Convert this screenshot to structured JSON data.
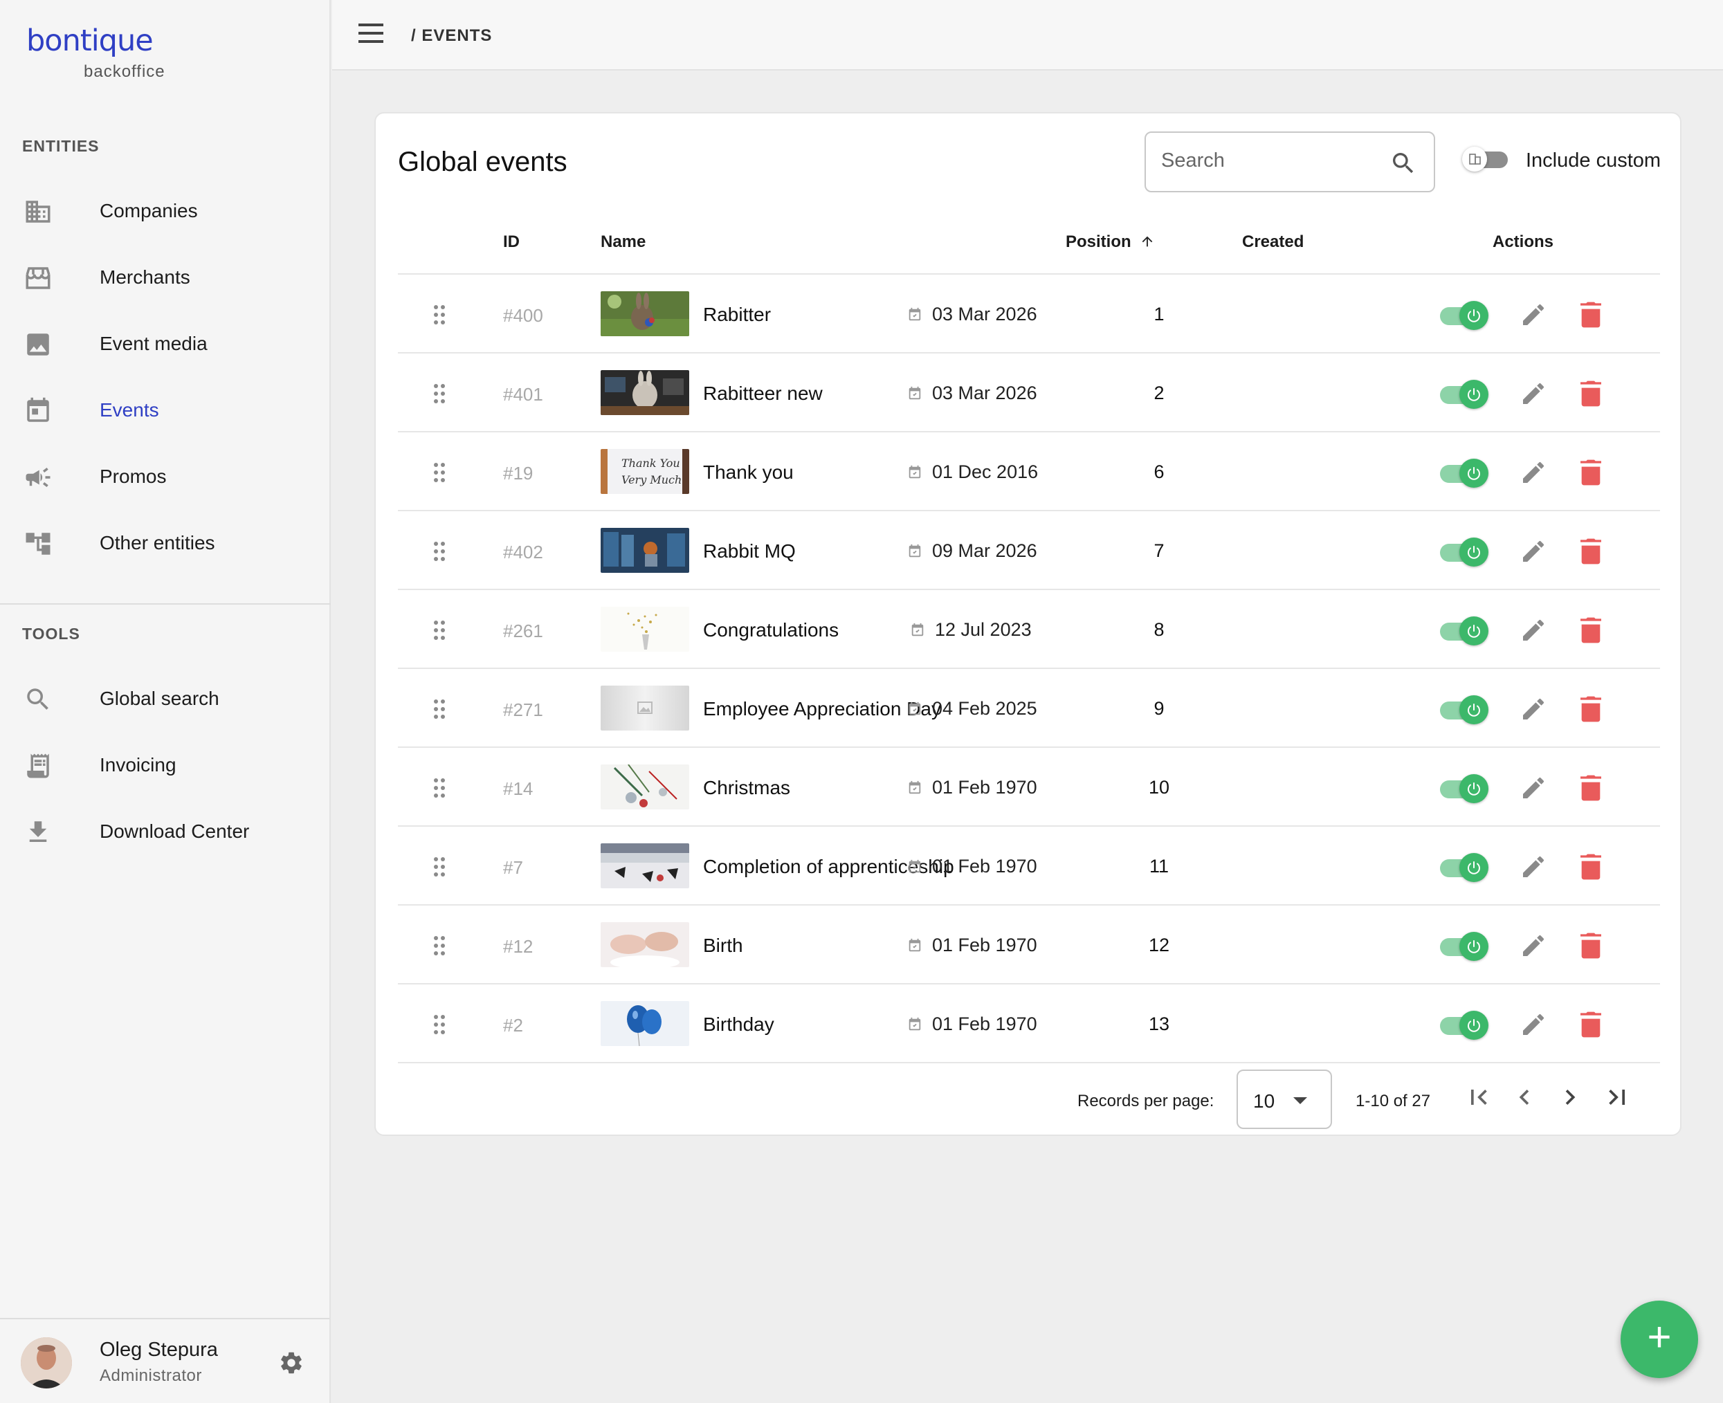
{
  "brand": {
    "name": "bontique",
    "subtitle": "backoffice",
    "color": "#2f3fc4"
  },
  "sidebar": {
    "entities_label": "ENTITIES",
    "entities": [
      {
        "label": "Companies",
        "icon": "building-icon"
      },
      {
        "label": "Merchants",
        "icon": "storefront-icon"
      },
      {
        "label": "Event media",
        "icon": "image-icon"
      },
      {
        "label": "Events",
        "icon": "calendar-icon",
        "active": true
      },
      {
        "label": "Promos",
        "icon": "megaphone-icon"
      },
      {
        "label": "Other entities",
        "icon": "hierarchy-icon"
      }
    ],
    "tools_label": "TOOLS",
    "tools": [
      {
        "label": "Global search",
        "icon": "search-icon"
      },
      {
        "label": "Invoicing",
        "icon": "receipt-icon"
      },
      {
        "label": "Download Center",
        "icon": "download-icon"
      }
    ],
    "user": {
      "name": "Oleg Stepura",
      "role": "Administrator"
    }
  },
  "topbar": {
    "breadcrumb": "/ EVENTS"
  },
  "main": {
    "title": "Global events",
    "search": {
      "placeholder": "Search",
      "value": ""
    },
    "include_custom": {
      "label": "Include custom",
      "on": false
    },
    "columns": {
      "id": "ID",
      "name": "Name",
      "position": "Position",
      "position_sort": "ascending",
      "created": "Created",
      "actions": "Actions"
    },
    "rows": [
      {
        "id": "#400",
        "name": "Rabitter",
        "position": "1",
        "created": "03 Mar 2026",
        "enabled": true
      },
      {
        "id": "#401",
        "name": "Rabitteer new",
        "position": "2",
        "created": "03 Mar 2026",
        "enabled": true
      },
      {
        "id": "#19",
        "name": "Thank you",
        "position": "6",
        "created": "01 Dec 2016",
        "enabled": true
      },
      {
        "id": "#402",
        "name": "Rabbit MQ",
        "position": "7",
        "created": "09 Mar 2026",
        "enabled": true
      },
      {
        "id": "#261",
        "name": "Congratulations",
        "position": "8",
        "created": "12 Jul 2023",
        "enabled": true
      },
      {
        "id": "#271",
        "name": "Employee Appreciation Day",
        "position": "9",
        "created": "04 Feb 2025",
        "enabled": true
      },
      {
        "id": "#14",
        "name": "Christmas",
        "position": "10",
        "created": "01 Feb 1970",
        "enabled": true
      },
      {
        "id": "#7",
        "name": "Completion of apprenticeship",
        "position": "11",
        "created": "01 Feb 1970",
        "enabled": true
      },
      {
        "id": "#12",
        "name": "Birth",
        "position": "12",
        "created": "01 Feb 1970",
        "enabled": true
      },
      {
        "id": "#2",
        "name": "Birthday",
        "position": "13",
        "created": "01 Feb 1970",
        "enabled": true
      }
    ],
    "pagination": {
      "records_label": "Records per page:",
      "per_page": "10",
      "range": "1-10 of 27"
    }
  },
  "colors": {
    "accent": "#2f3fc4",
    "success": "#3cb86a",
    "danger": "#e95b5b"
  }
}
